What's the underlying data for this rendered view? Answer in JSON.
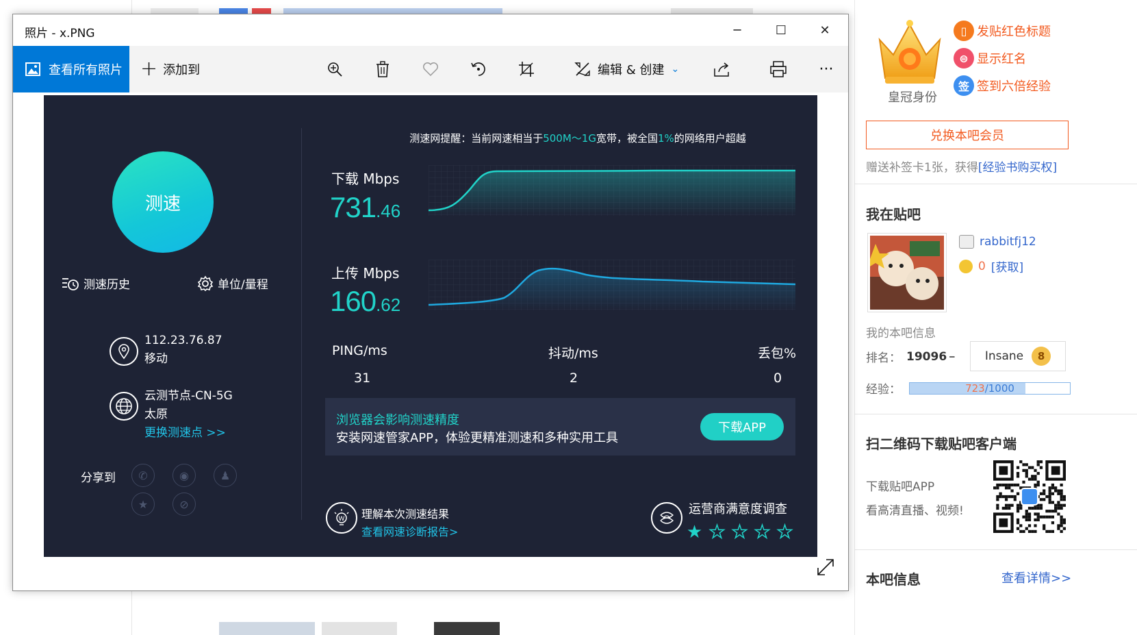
{
  "window": {
    "title": "照片 - x.PNG",
    "controls": {
      "minimize": "─",
      "maximize": "☐",
      "close": "✕"
    }
  },
  "toolbar": {
    "view_all": "查看所有照片",
    "add_to": "添加到",
    "edit_create": "编辑 & 创建",
    "icons": [
      "zoom-icon",
      "trash-icon",
      "heart-icon",
      "rotate-icon",
      "crop-icon",
      "share-icon",
      "print-icon",
      "more-icon"
    ]
  },
  "speedtest": {
    "start_button": "测速",
    "history": "测速历史",
    "unit_range": "单位/量程",
    "ip": "112.23.76.87",
    "isp": "移动",
    "node": "云测节点-CN-5G",
    "city": "太原",
    "change_node": "更换测速点 >>",
    "share_label": "分享到",
    "tip": {
      "prefix": "测速网提醒：当前网速相当于",
      "band": "500M～1G",
      "middle": "宽带，被全国",
      "percent": "1%",
      "suffix": "的网络用户超越"
    },
    "download": {
      "label": "下载 Mbps",
      "int": "731",
      "dec": ".46"
    },
    "upload": {
      "label": "上传 Mbps",
      "int": "160",
      "dec": ".62"
    },
    "stats": {
      "ping_label": "PING/ms",
      "ping": "31",
      "jitter_label": "抖动/ms",
      "jitter": "2",
      "loss_label": "丢包%",
      "loss": "0"
    },
    "promo": {
      "title": "浏览器会影响测速精度",
      "text": "安装网速管家APP，体验更精准测速和多种实用工具",
      "button": "下载APP"
    },
    "understand": "理解本次测速结果",
    "report_link": "查看网速诊断报告>",
    "survey": "运营商满意度调查",
    "rating": 1,
    "rating_max": 5,
    "accent": "#21d3c9",
    "background": "#1e2335"
  },
  "sidebar": {
    "crown_label": "皇冠身份",
    "perks": [
      "发贴红色标题",
      "显示红名",
      "签到六倍经验"
    ],
    "redeem": "兑换本吧会员",
    "gift_prefix": "赠送补签卡1张，获得",
    "gift_link": "[经验书购买权]",
    "my_bar_title": "我在贴吧",
    "username": "rabbitfj12",
    "coins": "0",
    "coins_link": "[获取]",
    "my_info": "我的本吧信息",
    "rank_label": "排名：",
    "rank": "19096",
    "rank_trend": "━",
    "level_name": "Insane",
    "level": "8",
    "exp_label": "经验：",
    "exp_current": "723",
    "exp_total": "/1000",
    "exp_fraction": 0.723,
    "qr_title": "扫二维码下载贴吧客户端",
    "qr_line1": "下载贴吧APP",
    "qr_line2": "看高清直播、视频!",
    "bar_info_title": "本吧信息",
    "details_link": "查看详情>>"
  }
}
